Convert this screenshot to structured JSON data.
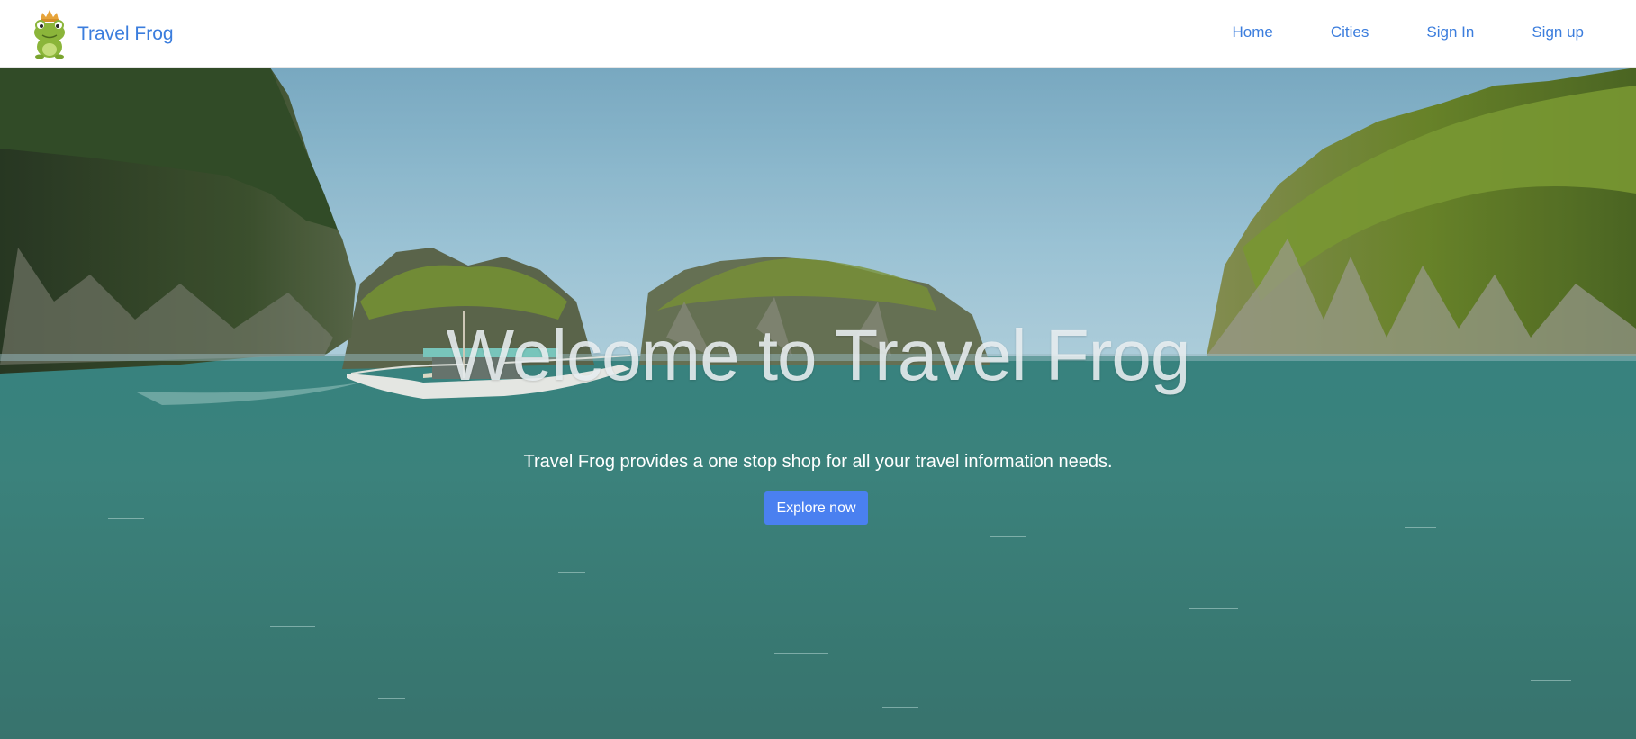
{
  "navbar": {
    "brand": {
      "name": "Travel Frog",
      "logo_icon": "frog-with-crown-icon"
    },
    "links": [
      {
        "label": "Home"
      },
      {
        "label": "Cities"
      },
      {
        "label": "Sign In"
      },
      {
        "label": "Sign up"
      }
    ]
  },
  "hero": {
    "background": "islands-lagoon-with-boat-photo",
    "title": "Welcome to Travel Frog",
    "subtitle": "Travel Frog provides a one stop shop for all your travel information needs.",
    "cta_label": "Explore now"
  },
  "colors": {
    "link": "#3b7ddd",
    "button": "#4a80f0",
    "navbar_bg": "#ffffff"
  }
}
